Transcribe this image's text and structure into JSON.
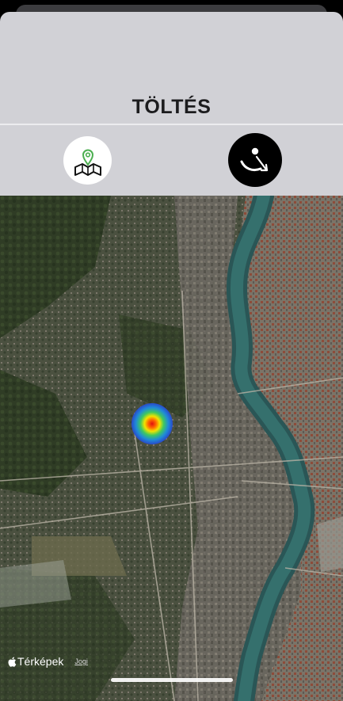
{
  "header": {
    "title": "TÖLTÉS"
  },
  "toolbar": {
    "map_button_icon": "map-pin-icon",
    "track_button_icon": "satellite-track-icon"
  },
  "map": {
    "attribution_brand": "Térképek",
    "attribution_legal": "Jogi",
    "heat_color_core": "#e01010",
    "heat_color_outer": "#2a44c8"
  }
}
